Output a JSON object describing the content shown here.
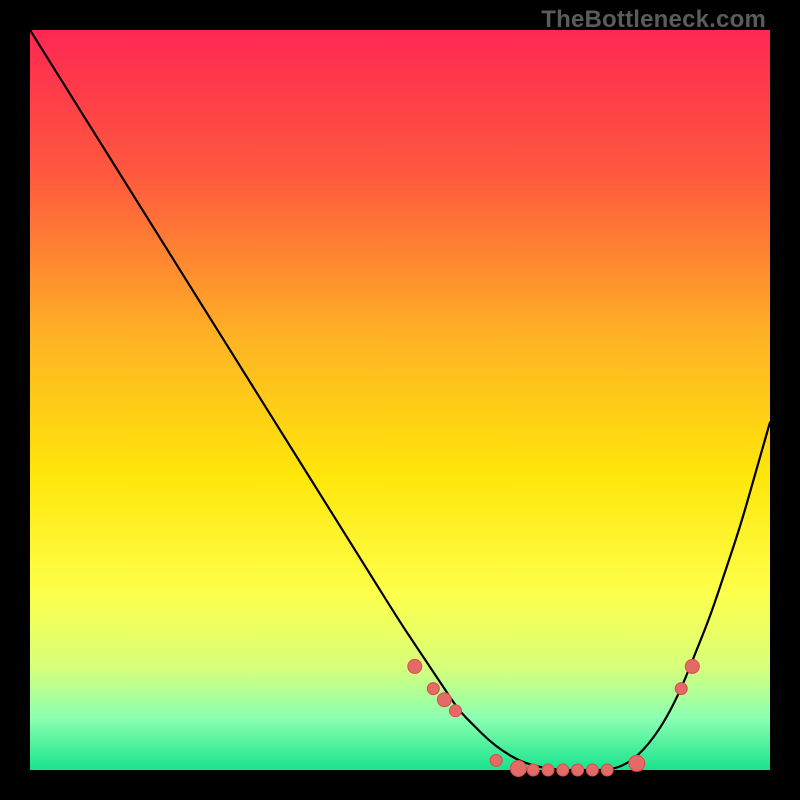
{
  "watermark": "TheBottleneck.com",
  "colors": {
    "bg_black": "#000000",
    "curve": "#000000",
    "dot_fill": "#e46a67",
    "dot_stroke": "#d24f4c",
    "gradient_stops": [
      {
        "pct": 0,
        "color": "#ff2752"
      },
      {
        "pct": 20,
        "color": "#ff5a3e"
      },
      {
        "pct": 42,
        "color": "#ffb424"
      },
      {
        "pct": 60,
        "color": "#ffe60a"
      },
      {
        "pct": 76,
        "color": "#fdff4a"
      },
      {
        "pct": 86,
        "color": "#d8ff7a"
      },
      {
        "pct": 93,
        "color": "#8bffb1"
      },
      {
        "pct": 100,
        "color": "#18e38c"
      }
    ]
  },
  "chart_data": {
    "type": "line",
    "title": "",
    "xlabel": "",
    "ylabel": "",
    "x": [
      0,
      5,
      10,
      15,
      20,
      25,
      30,
      35,
      40,
      45,
      50,
      52,
      54,
      56,
      58,
      60,
      62,
      64,
      66,
      68,
      70,
      72,
      74,
      76,
      78,
      80,
      82,
      84,
      86,
      88,
      90,
      92,
      94,
      96,
      98,
      100
    ],
    "values": [
      100,
      92,
      84,
      76,
      68,
      60,
      52,
      44,
      36,
      28,
      20,
      17,
      14,
      11,
      8,
      6,
      4,
      2.5,
      1.3,
      0.6,
      0.2,
      0,
      0,
      0,
      0,
      0.5,
      1.8,
      4,
      7,
      11,
      16,
      21,
      27,
      33,
      40,
      47
    ],
    "xlim": [
      0,
      100
    ],
    "ylim": [
      0,
      100
    ],
    "markers": {
      "x": [
        52,
        54.5,
        56,
        57.5,
        63,
        66,
        68,
        70,
        72,
        74,
        76,
        78,
        82,
        88,
        89.5
      ],
      "values": [
        14,
        11,
        9.5,
        8,
        1.3,
        0.2,
        0,
        0,
        0,
        0,
        0,
        0,
        0.9,
        11,
        14
      ],
      "radius": [
        7,
        6,
        7,
        6,
        6,
        8,
        6,
        6,
        6,
        6,
        6,
        6,
        8,
        6,
        7
      ]
    }
  }
}
